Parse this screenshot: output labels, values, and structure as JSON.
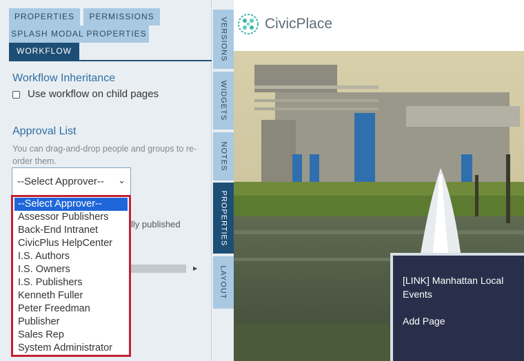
{
  "tabs": {
    "properties": "PROPERTIES",
    "permissions": "PERMISSIONS",
    "splash": "SPLASH MODAL PROPERTIES",
    "workflow": "WORKFLOW"
  },
  "workflow_inheritance": {
    "heading": "Workflow Inheritance",
    "checkbox_label": "Use workflow on child pages",
    "checked": false
  },
  "approval_list": {
    "heading": "Approval List",
    "help_text": "You can drag-and-drop people and groups to re-order them.",
    "select_value": "--Select Approver--",
    "partial_text": "lly published"
  },
  "dropdown": {
    "options": [
      "--Select Approver--",
      "Assessor Publishers",
      "Back-End Intranet",
      "CivicPlus HelpCenter",
      "I.S. Authors",
      "I.S. Owners",
      "I.S. Publishers",
      "Kenneth Fuller",
      "Peter Freedman",
      "Publisher",
      "Sales Rep",
      "System Administrator"
    ],
    "selected_index": 0,
    "highlight_color": "#c51f35"
  },
  "side_tabs": {
    "versions": "VERSIONS",
    "widgets": "WIDGETS",
    "notes": "NOTES",
    "properties": "PROPERTIES",
    "layout": "LAYOUT"
  },
  "site": {
    "logo_text": "CivicPlace",
    "logo_icon": "civicplace-logo-icon",
    "overlay_link": "[LINK] Manhattan Local Events",
    "overlay_add": "Add Page"
  },
  "colors": {
    "accent": "#1d4e75",
    "tab": "#a9c8e2",
    "overlay": "#292f4a"
  }
}
